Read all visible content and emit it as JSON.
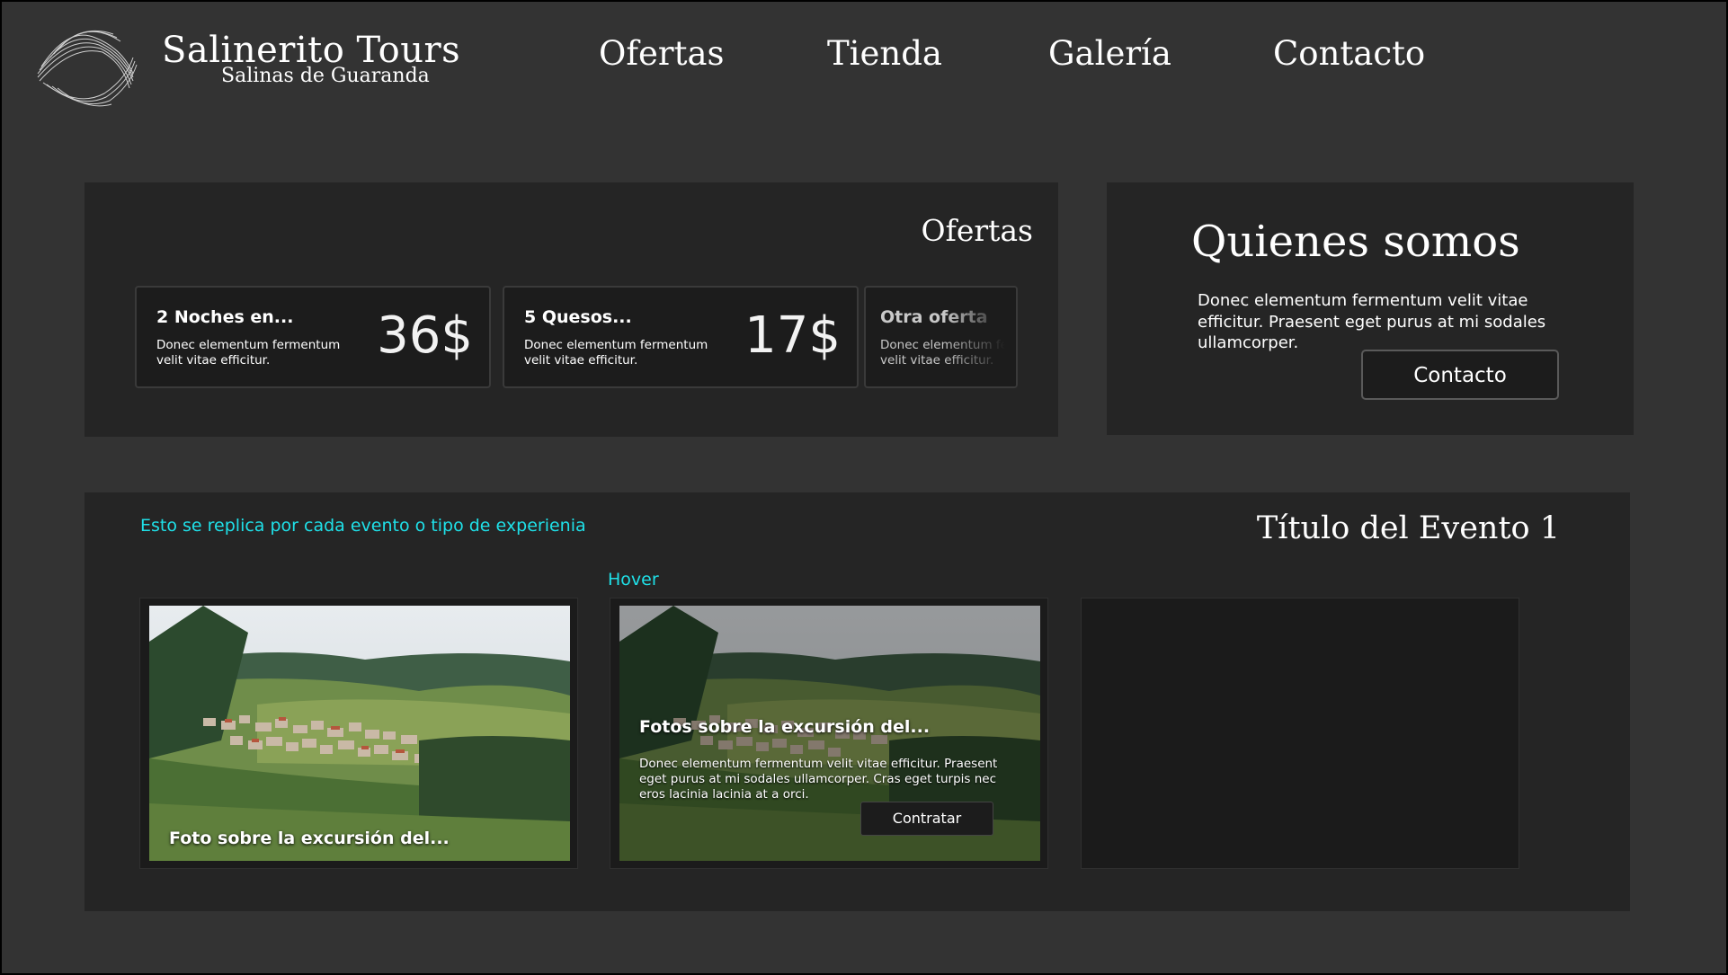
{
  "header": {
    "brand_title": "Salinerito Tours",
    "brand_subtitle": "Salinas de Guaranda",
    "nav": [
      "Ofertas",
      "Tienda",
      "Galería",
      "Contacto"
    ]
  },
  "offers": {
    "title": "Ofertas",
    "cards": [
      {
        "title": "2 Noches en...",
        "desc": "Donec elementum fermentum velit vitae efficitur.",
        "price": "36$"
      },
      {
        "title": "5 Quesos...",
        "desc": "Donec elementum fermentum velit vitae efficitur.",
        "price": "17$"
      },
      {
        "title": "Otra oferta",
        "desc": "Donec elementum fermentum velit vitae efficitur."
      }
    ]
  },
  "about": {
    "title": "Quienes somos",
    "text": "Donec elementum fermentum velit vitae efficitur. Praesent eget purus at mi sodales ullamcorper.",
    "button": "Contacto"
  },
  "events": {
    "note": "Esto se replica por cada evento o tipo de experienia",
    "hover_note": "Hover",
    "title": "Título del Evento 1",
    "tile1_caption": "Foto sobre la excursión del...",
    "tile2_title": "Fotos sobre la excursión del...",
    "tile2_desc": "Donec elementum fermentum velit vitae efficitur. Praesent eget purus at mi sodales ullamcorper. Cras eget turpis nec eros lacinia lacinia at a orci.",
    "tile2_button": "Contratar"
  },
  "colors": {
    "background": "#333333",
    "panel": "#252525",
    "card": "#1c1c1c",
    "annotation": "#1fe0e8"
  }
}
